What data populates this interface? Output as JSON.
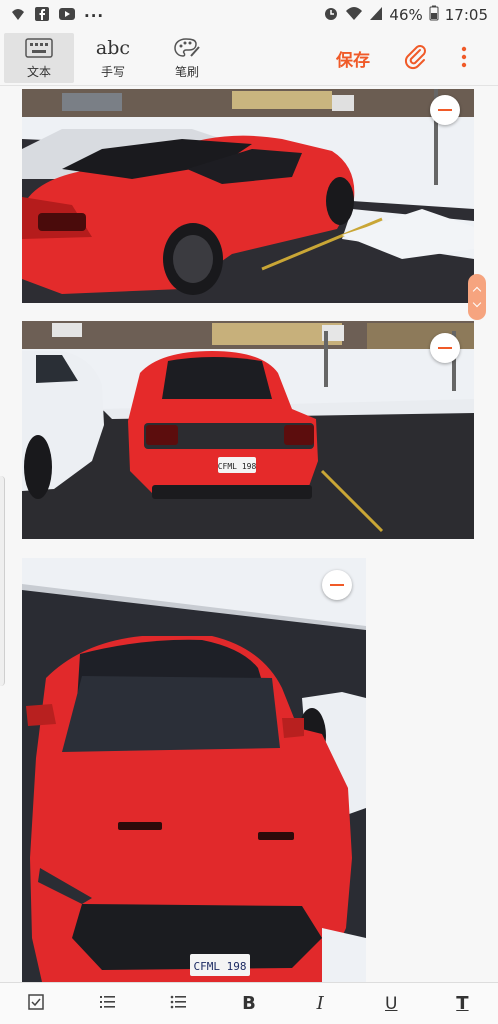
{
  "status": {
    "battery": "46%",
    "time": "17:05"
  },
  "toolbar": {
    "modes": [
      {
        "label": "文本",
        "icon": "keyboard-icon"
      },
      {
        "label": "手写",
        "icon": "handwriting-abc-icon",
        "glyph": "abc"
      },
      {
        "label": "笔刷",
        "icon": "palette-brush-icon"
      }
    ],
    "save_label": "保存",
    "accent": "#f05a28"
  },
  "photos": [
    {
      "name": "red mustang rear three-quarter view",
      "plate": ""
    },
    {
      "name": "red mustang rear view",
      "plate": "CFML 198"
    },
    {
      "name": "red mustang front overhead view",
      "plate": "CFML 198"
    }
  ],
  "format_bar": {
    "bold": "B",
    "italic": "I",
    "underline": "U",
    "text_style": "T"
  }
}
